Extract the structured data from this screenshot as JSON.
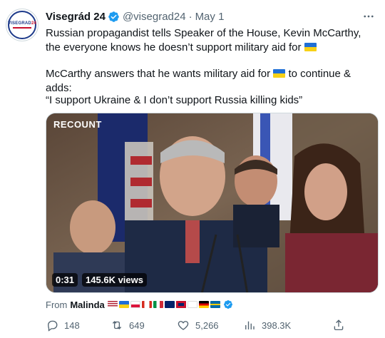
{
  "author": {
    "display_name": "Visegrád 24",
    "handle": "@visegrad24",
    "separator": "·",
    "date": "May 1",
    "avatar_text": "VISEGRAD",
    "avatar_num": "24"
  },
  "tweet": {
    "line1": "Russian propagandist tells Speaker of the House, Kevin McCarthy, the everyone knows he doesn’t support military aid for",
    "line2_a": "McCarthy answers that he wants military aid for",
    "line2_b": "to continue & adds:",
    "line3": "“I support Ukraine & I don’t support Russia killing kids”"
  },
  "media": {
    "source_logo": "RECOUNT",
    "duration": "0:31",
    "views": "145.6K views"
  },
  "from": {
    "prefix": "From",
    "name": "Malinda"
  },
  "actions": {
    "replies": "148",
    "retweets": "649",
    "likes": "5,266",
    "views": "398.3K"
  },
  "icons": {
    "verified": "verified-badge-icon",
    "more": "more-icon",
    "reply": "reply-icon",
    "retweet": "retweet-icon",
    "like": "heart-icon",
    "views": "views-icon",
    "share": "share-icon"
  },
  "colors": {
    "accent": "#1d9bf0",
    "text": "#0f1419",
    "secondary": "#536471"
  }
}
